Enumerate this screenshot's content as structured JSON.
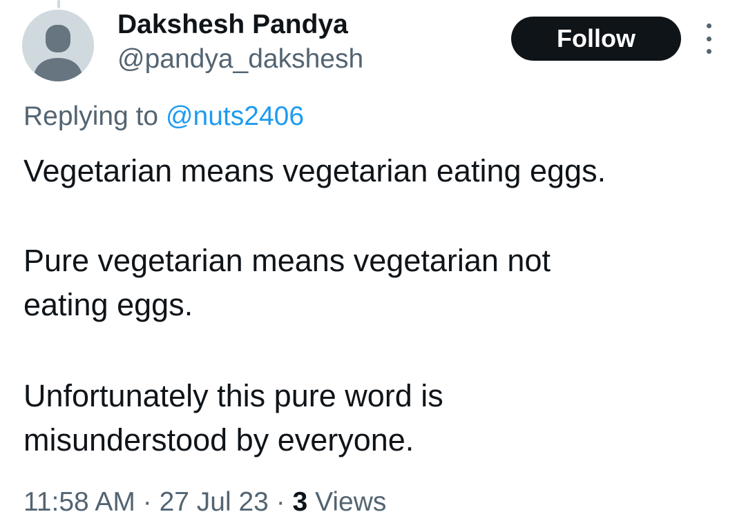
{
  "author": {
    "display_name": "Dakshesh Pandya",
    "handle": "@pandya_dakshesh"
  },
  "follow_button": {
    "label": "Follow"
  },
  "reply": {
    "prefix": "Replying to ",
    "to_handle": "@nuts2406"
  },
  "tweet": {
    "lines": [
      "Vegetarian means vegetarian eating eggs.",
      "Pure vegetarian means vegetarian not",
      "eating eggs.",
      "Unfortunately this pure word is",
      "misunderstood by everyone."
    ]
  },
  "meta": {
    "time": "11:58 AM",
    "separator": " · ",
    "date": "27 Jul 23",
    "views_count": "3",
    "views_label": " Views"
  },
  "colors": {
    "text_primary": "#0f1419",
    "text_secondary": "#536471",
    "link": "#1d9bf0",
    "avatar_bg": "#cfd9de"
  }
}
